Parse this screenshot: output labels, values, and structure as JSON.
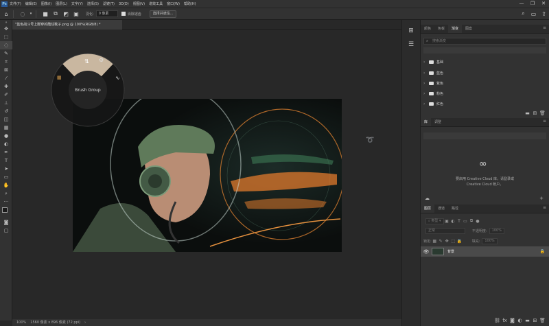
{
  "app": {
    "logo": "Ps"
  },
  "menu": [
    "文件(F)",
    "编辑(E)",
    "图像(I)",
    "图层(L)",
    "文字(Y)",
    "选择(S)",
    "滤镜(T)",
    "3D(D)",
    "视图(V)",
    "增效工具",
    "窗口(W)",
    "帮助(H)"
  ],
  "window_controls": {
    "minimize": "—",
    "restore": "❐",
    "close": "✕"
  },
  "options": {
    "feather_label": "羽化:",
    "feather_value": "0 像素",
    "antialias_label": "消除锯齿",
    "select_mask_button": "选择并遮住..."
  },
  "document": {
    "tab_title": "\"蓝色战斗号上脚穿的酷炫靴子.png @ 100%(RGB/8) *",
    "zoom": "100%",
    "size_info": "1560 像素 x 896 像素 (72 ppi)"
  },
  "radial_menu": {
    "label": "Brush Group"
  },
  "swatches_panel": {
    "tabs": [
      "颜色",
      "色板",
      "渐变",
      "图案"
    ],
    "active_tab": 2,
    "search_placeholder": "搜索渐变",
    "folders": [
      "基础",
      "蓝色",
      "紫色",
      "粉色",
      "红色"
    ]
  },
  "libraries_panel": {
    "tabs": [
      "库",
      "调整"
    ],
    "message_line1": "要启用 Creative Cloud 库，请登录或",
    "message_line2": "Creative Cloud 帐户。",
    "add_label": "+"
  },
  "layers_panel": {
    "tabs": [
      "图层",
      "通道",
      "路径"
    ],
    "kind_label": "类型",
    "blend_mode": "正常",
    "opacity_label": "不透明度:",
    "opacity_value": "100%",
    "lock_label": "锁定:",
    "fill_label": "填充:",
    "fill_value": "100%",
    "layer_name": "背景"
  },
  "colors": {
    "foreground": "#1a1a1a",
    "background": "#ffffff",
    "accent_orange": "#e07a2c",
    "radial_wedge": "#c9b7a0"
  }
}
